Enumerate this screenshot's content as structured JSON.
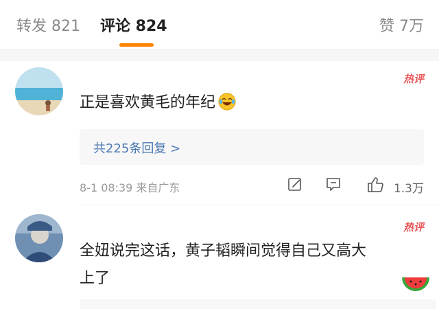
{
  "tabs": {
    "repost_label": "转发 821",
    "comments_label": "评论 824",
    "likes_label": "赞 7万"
  },
  "comments": [
    {
      "hot_tag": "热评",
      "text_lines": [
        "正是喜欢黄毛的年纪"
      ],
      "emoji": "laughing-tears",
      "replies_link": "共225条回复 >",
      "meta": "8-1 08:39 来自广东",
      "like_count": "1.3万"
    },
    {
      "hot_tag": "热评",
      "text_lines": [
        "全妞说完这话，黄子韬瞬间觉得自己又高大",
        "上了"
      ]
    }
  ],
  "colors": {
    "accent": "#ff8200",
    "link": "#4a78b3",
    "hot_tag": "#e9585b"
  }
}
